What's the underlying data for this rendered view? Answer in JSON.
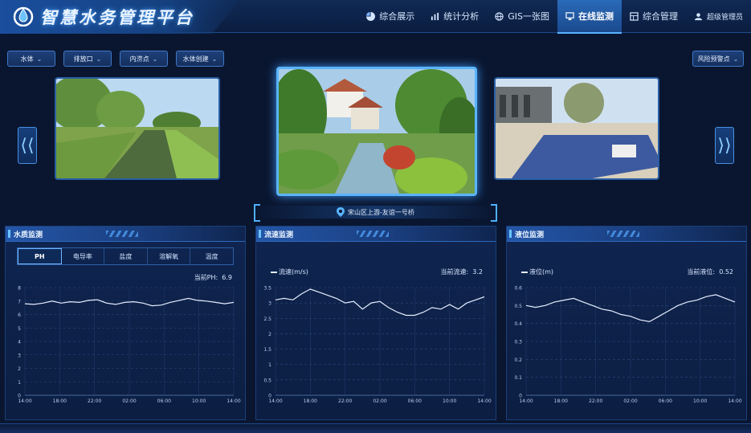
{
  "header": {
    "app_title": "智慧水务管理平台",
    "nav": [
      {
        "label": "综合展示",
        "icon": "pie-icon"
      },
      {
        "label": "统计分析",
        "icon": "bar-chart-icon"
      },
      {
        "label": "GIS一张图",
        "icon": "globe-icon"
      },
      {
        "label": "在线监测",
        "icon": "monitor-icon",
        "active": true
      },
      {
        "label": "综合管理",
        "icon": "grid-icon"
      }
    ],
    "user": "超级管理员"
  },
  "filters": {
    "water_body": "水体",
    "outlet": "排放口",
    "point": "内涝点",
    "body_check": "水体创建",
    "risk": "风险预警点"
  },
  "location": "宋山区上游-友谊一号桥",
  "colors": {
    "accent": "#5ab4ff",
    "line": "#e6eeff",
    "panel": "#0f2550"
  },
  "panels": {
    "water_quality": {
      "title": "水质监测",
      "tabs": [
        "PH",
        "电导率",
        "盐度",
        "溶解氧",
        "温度"
      ],
      "active_tab": "PH",
      "current_label": "当前PH:",
      "current_value": "6.9"
    },
    "flow": {
      "title": "流速监测",
      "legend": "流速(m/s)",
      "current_label": "当前流速:",
      "current_value": "3.2"
    },
    "level": {
      "title": "液位监测",
      "legend": "液位(m)",
      "current_label": "当前液位:",
      "current_value": "0.52"
    }
  },
  "chart_data": [
    {
      "type": "line",
      "title": "",
      "x": [
        "14:00",
        "18:00",
        "22:00",
        "02:00",
        "06:00",
        "10:00",
        "14:00"
      ],
      "ylim": [
        0,
        8
      ],
      "yticks": [
        0,
        1,
        2,
        3,
        4,
        5,
        6,
        7,
        8
      ],
      "series": [
        {
          "values": [
            6.8,
            6.75,
            6.85,
            7.0,
            6.85,
            6.95,
            6.9,
            7.05,
            7.1,
            6.85,
            6.75,
            6.9,
            6.95,
            6.85,
            6.65,
            6.7,
            6.9,
            7.05,
            7.2,
            7.05,
            7.0,
            6.9,
            6.8,
            6.9
          ]
        }
      ]
    },
    {
      "type": "line",
      "title": "",
      "x": [
        "14:00",
        "18:00",
        "22:00",
        "02:00",
        "06:00",
        "10:00",
        "14:00"
      ],
      "ylim": [
        0,
        3.5
      ],
      "yticks": [
        0,
        0.5,
        1,
        1.5,
        2,
        2.5,
        3,
        3.5
      ],
      "series": [
        {
          "name": "流速(m/s)",
          "values": [
            3.1,
            3.15,
            3.1,
            3.3,
            3.45,
            3.35,
            3.25,
            3.15,
            3.0,
            3.05,
            2.8,
            3.0,
            3.05,
            2.85,
            2.7,
            2.6,
            2.6,
            2.7,
            2.85,
            2.8,
            2.95,
            2.8,
            3.0,
            3.1,
            3.2
          ]
        }
      ]
    },
    {
      "type": "line",
      "title": "",
      "x": [
        "14:00",
        "18:00",
        "22:00",
        "02:00",
        "06:00",
        "10:00",
        "14:00"
      ],
      "ylim": [
        0,
        0.6
      ],
      "yticks": [
        0,
        0.1,
        0.2,
        0.3,
        0.4,
        0.5,
        0.6
      ],
      "series": [
        {
          "name": "液位(m)",
          "values": [
            0.5,
            0.49,
            0.5,
            0.52,
            0.53,
            0.54,
            0.52,
            0.5,
            0.48,
            0.47,
            0.45,
            0.44,
            0.42,
            0.41,
            0.44,
            0.47,
            0.5,
            0.52,
            0.53,
            0.55,
            0.56,
            0.54,
            0.52
          ]
        }
      ]
    }
  ]
}
